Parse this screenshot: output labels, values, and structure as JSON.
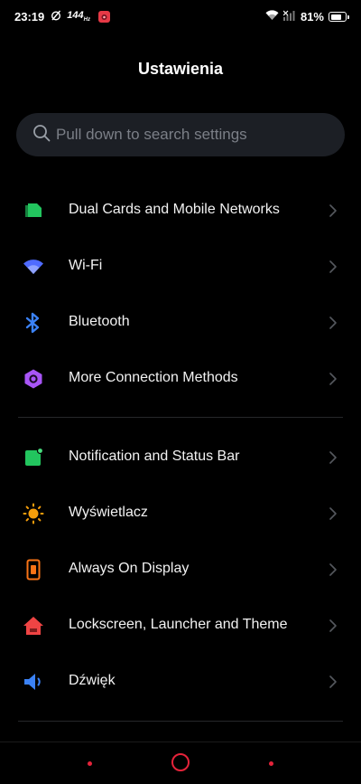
{
  "status_bar": {
    "time": "23:19",
    "refresh_rate": "144",
    "refresh_unit": "Hz",
    "battery": "81%",
    "battery_level": 0.81
  },
  "header": {
    "title": "Ustawienia"
  },
  "search": {
    "placeholder": "Pull down to search settings"
  },
  "groups": [
    {
      "items": [
        {
          "label": "Dual Cards and Mobile Networks",
          "icon": "sim-card-icon",
          "color": "#22c55e"
        },
        {
          "label": "Wi-Fi",
          "icon": "wifi-icon",
          "color": "#4f6bff"
        },
        {
          "label": "Bluetooth",
          "icon": "bluetooth-icon",
          "color": "#3b82f6"
        },
        {
          "label": "More Connection Methods",
          "icon": "hexagon-link-icon",
          "color": "#a855f7"
        }
      ]
    },
    {
      "items": [
        {
          "label": "Notification and Status Bar",
          "icon": "notification-icon",
          "color": "#22c55e"
        },
        {
          "label": "Wyświetlacz",
          "icon": "sun-icon",
          "color": "#f59e0b"
        },
        {
          "label": "Always On Display",
          "icon": "always-on-display-icon",
          "color": "#f97316"
        },
        {
          "label": "Lockscreen, Launcher and Theme",
          "icon": "home-theme-icon",
          "color": "#ef4444"
        },
        {
          "label": "Dźwięk",
          "icon": "speaker-icon",
          "color": "#3b82f6"
        }
      ]
    }
  ],
  "nav": {
    "accent": "#e5233a"
  }
}
